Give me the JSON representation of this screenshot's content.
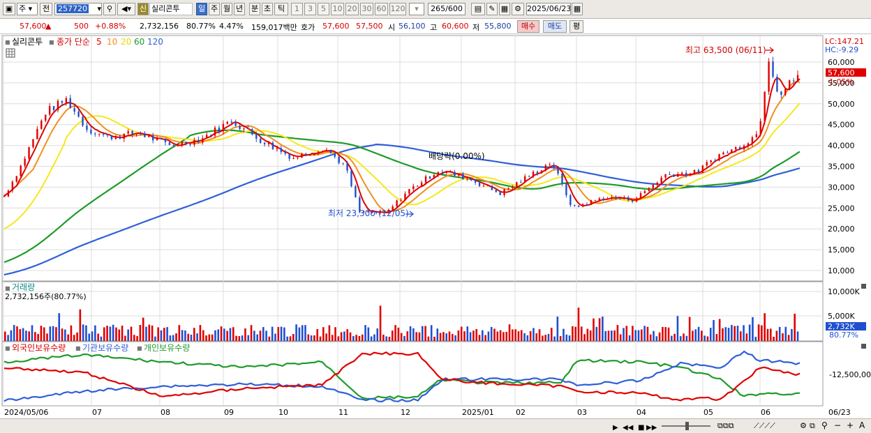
{
  "toolbar": {
    "period_type": "주",
    "prev_label": "전",
    "code_value": "257720",
    "new_badge": "신",
    "stock_name": "실리콘투",
    "periods": [
      "일",
      "주",
      "월",
      "년",
      "분",
      "초",
      "틱"
    ],
    "active_period": "일",
    "intervals": [
      "1",
      "3",
      "5",
      "10",
      "20",
      "30",
      "60",
      "120"
    ],
    "count": "265",
    "count_total": "/600",
    "date": "2025/06/23"
  },
  "price_row": {
    "price": "57,600",
    "change": "500",
    "change_pct": "+0.88%",
    "volume": "2,732,156",
    "vol_ratio": "80.77%",
    "turnover": "4.47%",
    "amount": "159,017백만",
    "hoga_label": "호가",
    "ask": "57,600",
    "bid": "57,500",
    "open_label": "시",
    "open": "56,100",
    "high_label": "고",
    "high": "60,600",
    "low_label": "저",
    "low": "55,800",
    "buy_label": "매수",
    "sell_label": "매도",
    "eval_label": "평"
  },
  "main_panel": {
    "name": "실리콘투",
    "indicator": "종가 단순",
    "ma_periods": [
      "5",
      "10",
      "20",
      "60",
      "120"
    ],
    "lc": "LC:147.21",
    "hc": "HC:-9.29",
    "cur_price": "57,600",
    "cur_pct": "1.05%",
    "high_annot": "최고 63,500 (06/11)",
    "low_annot": "최저 23,300 (12/05)",
    "div_annot": "배당락(0.00%)",
    "y_labels": [
      "60,000",
      "55,000",
      "50,000",
      "45,000",
      "40,000",
      "35,000",
      "30,000",
      "25,000",
      "20,000",
      "15,000",
      "10,000"
    ]
  },
  "volume_panel": {
    "title": "거래량",
    "info": "2,732,156주(80.77%)",
    "y_labels": [
      "10,000K",
      "5,000K"
    ],
    "cur": "2,732K",
    "cur_pct": "80.77%"
  },
  "holder_panel": {
    "series": [
      "외국인보유수량",
      "기관보유수량",
      "개인보유수량"
    ],
    "y_label": "-12,500,00"
  },
  "x_axis": [
    "2024/05/06",
    "07",
    "08",
    "09",
    "10",
    "11",
    "12",
    "2025/01",
    "02",
    "03",
    "04",
    "05",
    "06",
    "06/23"
  ],
  "colors": {
    "ma5": "#e00000",
    "ma10": "#f0901c",
    "ma20": "#f5e81a",
    "ma60": "#1e9a2a",
    "ma120": "#2f5fd8",
    "up": "#e00000",
    "down": "#1f4fcf"
  }
}
